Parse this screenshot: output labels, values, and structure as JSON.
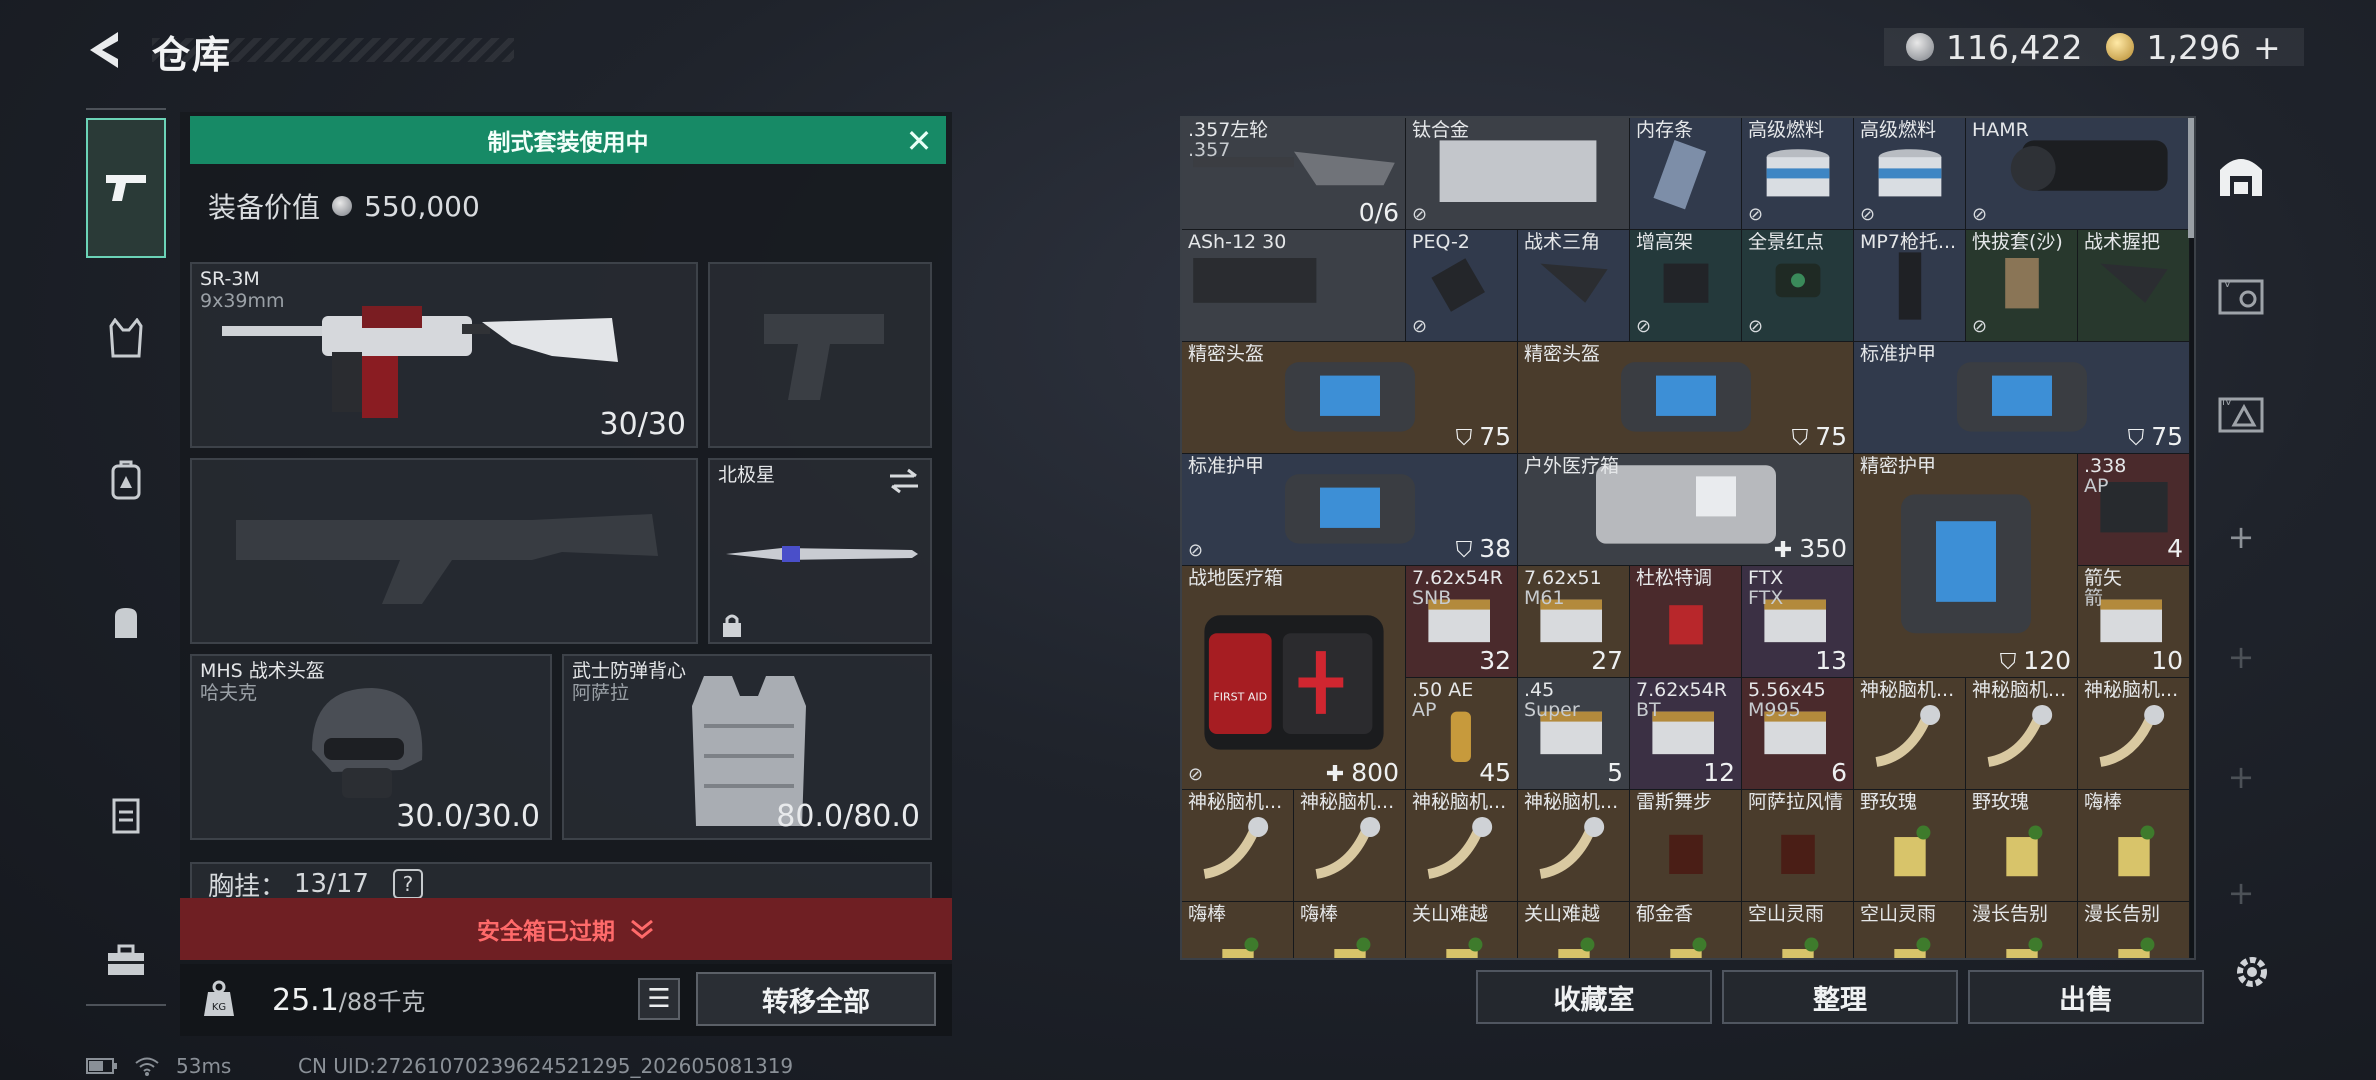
{
  "header": {
    "title": "仓库",
    "currencies": [
      {
        "icon": "silver-coin-icon",
        "value": "116,422"
      },
      {
        "icon": "gold-coin-icon",
        "value": "1,296"
      }
    ],
    "add_label": "+"
  },
  "kit_banner": "制式套装使用中",
  "equip_value": {
    "label": "装备价值",
    "value": "550,000"
  },
  "slots": {
    "primary": {
      "name": "SR-3M",
      "sub": "9x39mm",
      "value": "30/30"
    },
    "knife": {
      "name": "北极星"
    },
    "helmet": {
      "name": "MHS 战术头盔",
      "sub": "哈夫克",
      "value": "30.0/30.0"
    },
    "armor": {
      "name": "武士防弹背心",
      "sub": "阿萨拉",
      "value": "80.0/80.0"
    }
  },
  "chest_rig": {
    "label": "胸挂：",
    "value": "13/17",
    "help": "?"
  },
  "safebox": "安全箱已过期",
  "weight": {
    "value": "25.1",
    "max": "/88千克"
  },
  "transfer_all": "转移全部",
  "status": {
    "ping": "53ms",
    "uid": "CN UID:27261070239624521295_202605081319"
  },
  "inventory": [
    {
      "name": ".357左轮",
      "sub": ".357",
      "count": "0/6",
      "bg": "gray",
      "art": "revolver"
    },
    {
      "name": "钛合金",
      "bg": "gray",
      "art": "plate",
      "lock": true
    },
    {
      "name": "内存条",
      "bg": "blue",
      "art": "ram"
    },
    {
      "name": "高级燃料",
      "bg": "blue",
      "art": "can",
      "lock": true
    },
    {
      "name": "高级燃料",
      "bg": "blue",
      "art": "can",
      "lock": true
    },
    {
      "name": "HAMR",
      "bg": "blue",
      "art": "scope",
      "lock": true
    },
    {
      "name": "ASh-12 30",
      "bg": "gray",
      "art": "mag"
    },
    {
      "name": "PEQ-2",
      "bg": "blue",
      "art": "peq",
      "lock": true
    },
    {
      "name": "战术三角",
      "bg": "blue",
      "art": "grip"
    },
    {
      "name": "增高架",
      "bg": "teal",
      "art": "mount",
      "lock": true
    },
    {
      "name": "全景红点",
      "bg": "teal",
      "art": "reddot",
      "lock": true
    },
    {
      "name": "MP7枪托...",
      "bg": "blue",
      "art": "stock"
    },
    {
      "name": "快拔套(沙)",
      "bg": "green",
      "art": "holster",
      "lock": true
    },
    {
      "name": "战术握把",
      "bg": "green",
      "art": "grip2"
    },
    {
      "name": "精密头盔",
      "count": "75",
      "bg": "brown",
      "art": "bag",
      "shield": true
    },
    {
      "name": "精密头盔",
      "count": "75",
      "bg": "brown",
      "art": "bag",
      "shield": true
    },
    {
      "name": "标准护甲",
      "count": "75",
      "bg": "blue",
      "art": "bag",
      "shield": true
    },
    {
      "name": "标准护甲",
      "count": "38",
      "bg": "blue",
      "art": "bag",
      "shield": true,
      "lock": true
    },
    {
      "name": "户外医疗箱",
      "count": "350",
      "bg": "gray",
      "art": "medkit2",
      "heal": true
    },
    {
      "name": "精密护甲",
      "count": "120",
      "bg": "brown",
      "art": "bag",
      "shield": true
    },
    {
      "name": ".338",
      "sub": "AP",
      "count": "4",
      "bg": "red",
      "art": "ammobox"
    },
    {
      "name": "战地医疗箱",
      "count": "800",
      "bg": "brown",
      "art": "firstaid",
      "heal": true,
      "lock": true,
      "aid_text": "FIRST AID"
    },
    {
      "name": "7.62x54R",
      "sub": "SNB",
      "count": "32",
      "bg": "red",
      "art": "ammo"
    },
    {
      "name": "7.62x51",
      "sub": "M61",
      "count": "27",
      "bg": "brown",
      "art": "ammo"
    },
    {
      "name": "杜松特调",
      "bg": "red",
      "art": "drink"
    },
    {
      "name": "FTX",
      "sub": "FTX",
      "count": "13",
      "bg": "purple",
      "art": "ammo"
    },
    {
      "name": "箭矢",
      "sub": "箭",
      "count": "10",
      "bg": "brown",
      "art": "ammo"
    },
    {
      "name": ".50 AE",
      "sub": "AP",
      "count": "45",
      "bg": "brown",
      "art": "bullet"
    },
    {
      "name": ".45",
      "sub": "Super",
      "count": "5",
      "bg": "gray",
      "art": "ammo"
    },
    {
      "name": "7.62x54R",
      "sub": "BT",
      "count": "12",
      "bg": "purple",
      "art": "ammo"
    },
    {
      "name": "5.56x45",
      "sub": "M995",
      "count": "6",
      "bg": "red",
      "art": "ammo"
    },
    {
      "name": "神秘脑机...",
      "bg": "brown",
      "art": "brain"
    },
    {
      "name": "神秘脑机...",
      "bg": "brown",
      "art": "brain"
    },
    {
      "name": "神秘脑机...",
      "bg": "brown",
      "art": "brain"
    },
    {
      "name": "神秘脑机...",
      "bg": "brown",
      "art": "brain"
    },
    {
      "name": "神秘脑机...",
      "bg": "brown",
      "art": "brain"
    },
    {
      "name": "神秘脑机...",
      "bg": "brown",
      "art": "brain"
    },
    {
      "name": "神秘脑机...",
      "bg": "brown",
      "art": "brain"
    },
    {
      "name": "雷斯舞步",
      "bg": "brown",
      "art": "drink2"
    },
    {
      "name": "阿萨拉风情",
      "bg": "brown",
      "art": "drink2"
    },
    {
      "name": "野玫瑰",
      "bg": "brown",
      "art": "cocktail"
    },
    {
      "name": "野玫瑰",
      "bg": "brown",
      "art": "cocktail"
    },
    {
      "name": "嗨棒",
      "bg": "brown",
      "art": "cocktail"
    },
    {
      "name": "嗨棒",
      "bg": "brown",
      "art": "cocktail"
    },
    {
      "name": "嗨棒",
      "bg": "brown",
      "art": "cocktail"
    },
    {
      "name": "关山难越",
      "bg": "brown",
      "art": "cocktail"
    },
    {
      "name": "关山难越",
      "bg": "brown",
      "art": "cocktail"
    },
    {
      "name": "郁金香",
      "bg": "brown",
      "art": "cocktail"
    },
    {
      "name": "空山灵雨",
      "bg": "brown",
      "art": "cocktail"
    },
    {
      "name": "空山灵雨",
      "bg": "brown",
      "art": "cocktail"
    },
    {
      "name": "漫长告别",
      "bg": "brown",
      "art": "cocktail"
    },
    {
      "name": "漫长告别",
      "bg": "brown",
      "art": "cocktail"
    }
  ],
  "buttons": {
    "collection": "收藏室",
    "organize": "整理",
    "sell": "出售"
  },
  "right_tabs": [
    "warehouse-icon",
    "case-icon",
    "case-iv-icon"
  ],
  "colors": {
    "accent": "#178a66",
    "danger": "#6f1f23",
    "danger_text": "#ff6a6a"
  }
}
